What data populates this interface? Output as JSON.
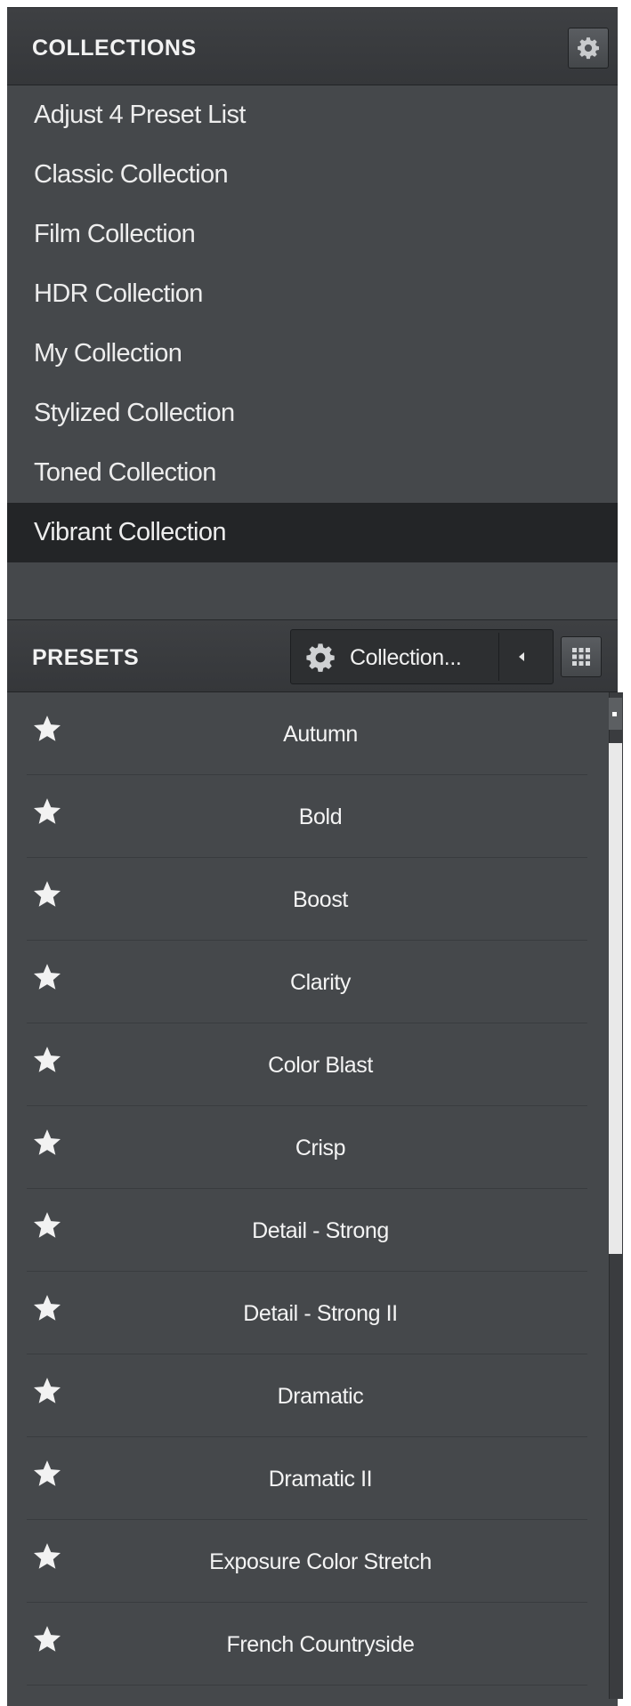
{
  "collections": {
    "title": "COLLECTIONS",
    "settings_icon": "gear-icon",
    "items": [
      {
        "label": "Adjust 4 Preset List"
      },
      {
        "label": "Classic Collection"
      },
      {
        "label": "Film Collection"
      },
      {
        "label": "HDR Collection"
      },
      {
        "label": "My Collection"
      },
      {
        "label": "Stylized Collection"
      },
      {
        "label": "Toned Collection"
      },
      {
        "label": "Vibrant Collection",
        "selected": true
      }
    ]
  },
  "presets": {
    "title": "PRESETS",
    "dropdown": {
      "label": "Collection...",
      "icon": "gear-icon",
      "arrow_icon": "triangle-left-icon"
    },
    "view_toggle_icon": "grid-icon",
    "items": [
      {
        "label": "Autumn"
      },
      {
        "label": "Bold"
      },
      {
        "label": "Boost"
      },
      {
        "label": "Clarity"
      },
      {
        "label": "Color Blast"
      },
      {
        "label": "Crisp"
      },
      {
        "label": "Detail - Strong"
      },
      {
        "label": "Detail - Strong II"
      },
      {
        "label": "Dramatic"
      },
      {
        "label": "Dramatic II"
      },
      {
        "label": "Exposure Color Stretch"
      },
      {
        "label": "French Countryside"
      }
    ]
  },
  "colors": {
    "panel_bg": "#45484b",
    "selected_bg": "#232527",
    "text": "#ededed"
  }
}
